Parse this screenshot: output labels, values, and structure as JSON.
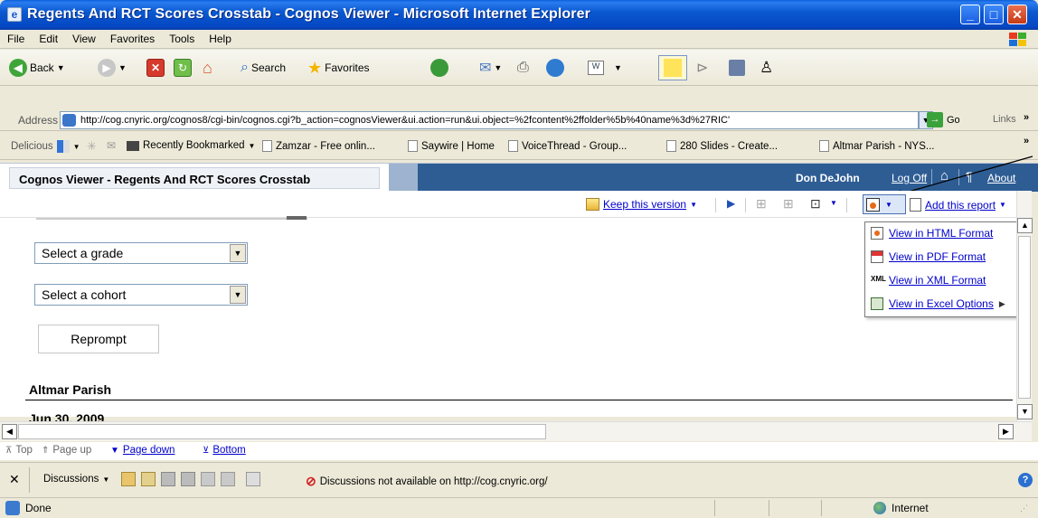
{
  "window": {
    "title": "Regents And RCT Scores Crosstab - Cognos Viewer - Microsoft Internet Explorer"
  },
  "menu": [
    "File",
    "Edit",
    "View",
    "Favorites",
    "Tools",
    "Help"
  ],
  "toolbar": {
    "back_label": "Back",
    "search_label": "Search",
    "favorites_label": "Favorites"
  },
  "address": {
    "label": "Address",
    "url": "http://cog.cnyric.org/cognos8/cgi-bin/cognos.cgi?b_action=cognosViewer&ui.action=run&ui.object=%2fcontent%2ffolder%5b%40name%3d%27RIC'",
    "go_label": "Go",
    "links_label": "Links"
  },
  "links_bar": {
    "delicious_label": "Delicious",
    "items": [
      "Recently Bookmarked",
      "Zamzar - Free onlin...",
      "Saywire | Home",
      "VoiceThread - Group...",
      "280 Slides - Create...",
      "Altmar Parish - NYS..."
    ]
  },
  "cognos": {
    "title": "Cognos Viewer - Regents And RCT Scores Crosstab",
    "user": "Don DeJohn",
    "logoff": "Log Off",
    "about": "About",
    "keep_version": "Keep this version",
    "add_report": "Add this report"
  },
  "prompts": {
    "grade_placeholder": "Select a grade",
    "cohort_placeholder": "Select a cohort",
    "reprompt_label": "Reprompt"
  },
  "report": {
    "school": "Altmar Parish",
    "date": "Jun 30, 2009"
  },
  "format_menu": {
    "items": [
      {
        "label": "View in HTML Format",
        "icon": "html-icon"
      },
      {
        "label": "View in PDF Format",
        "icon": "pdf-icon"
      },
      {
        "label": "View in XML Format",
        "icon": "xml-icon"
      },
      {
        "label": "View in Excel Options",
        "icon": "excel-icon"
      }
    ]
  },
  "page_nav": {
    "top": "Top",
    "page_up": "Page up",
    "page_down": "Page down",
    "bottom": "Bottom"
  },
  "discussions": {
    "label": "Discussions",
    "status": "Discussions not available on http://cog.cnyric.org/"
  },
  "status": {
    "text": "Done",
    "zone": "Internet"
  }
}
